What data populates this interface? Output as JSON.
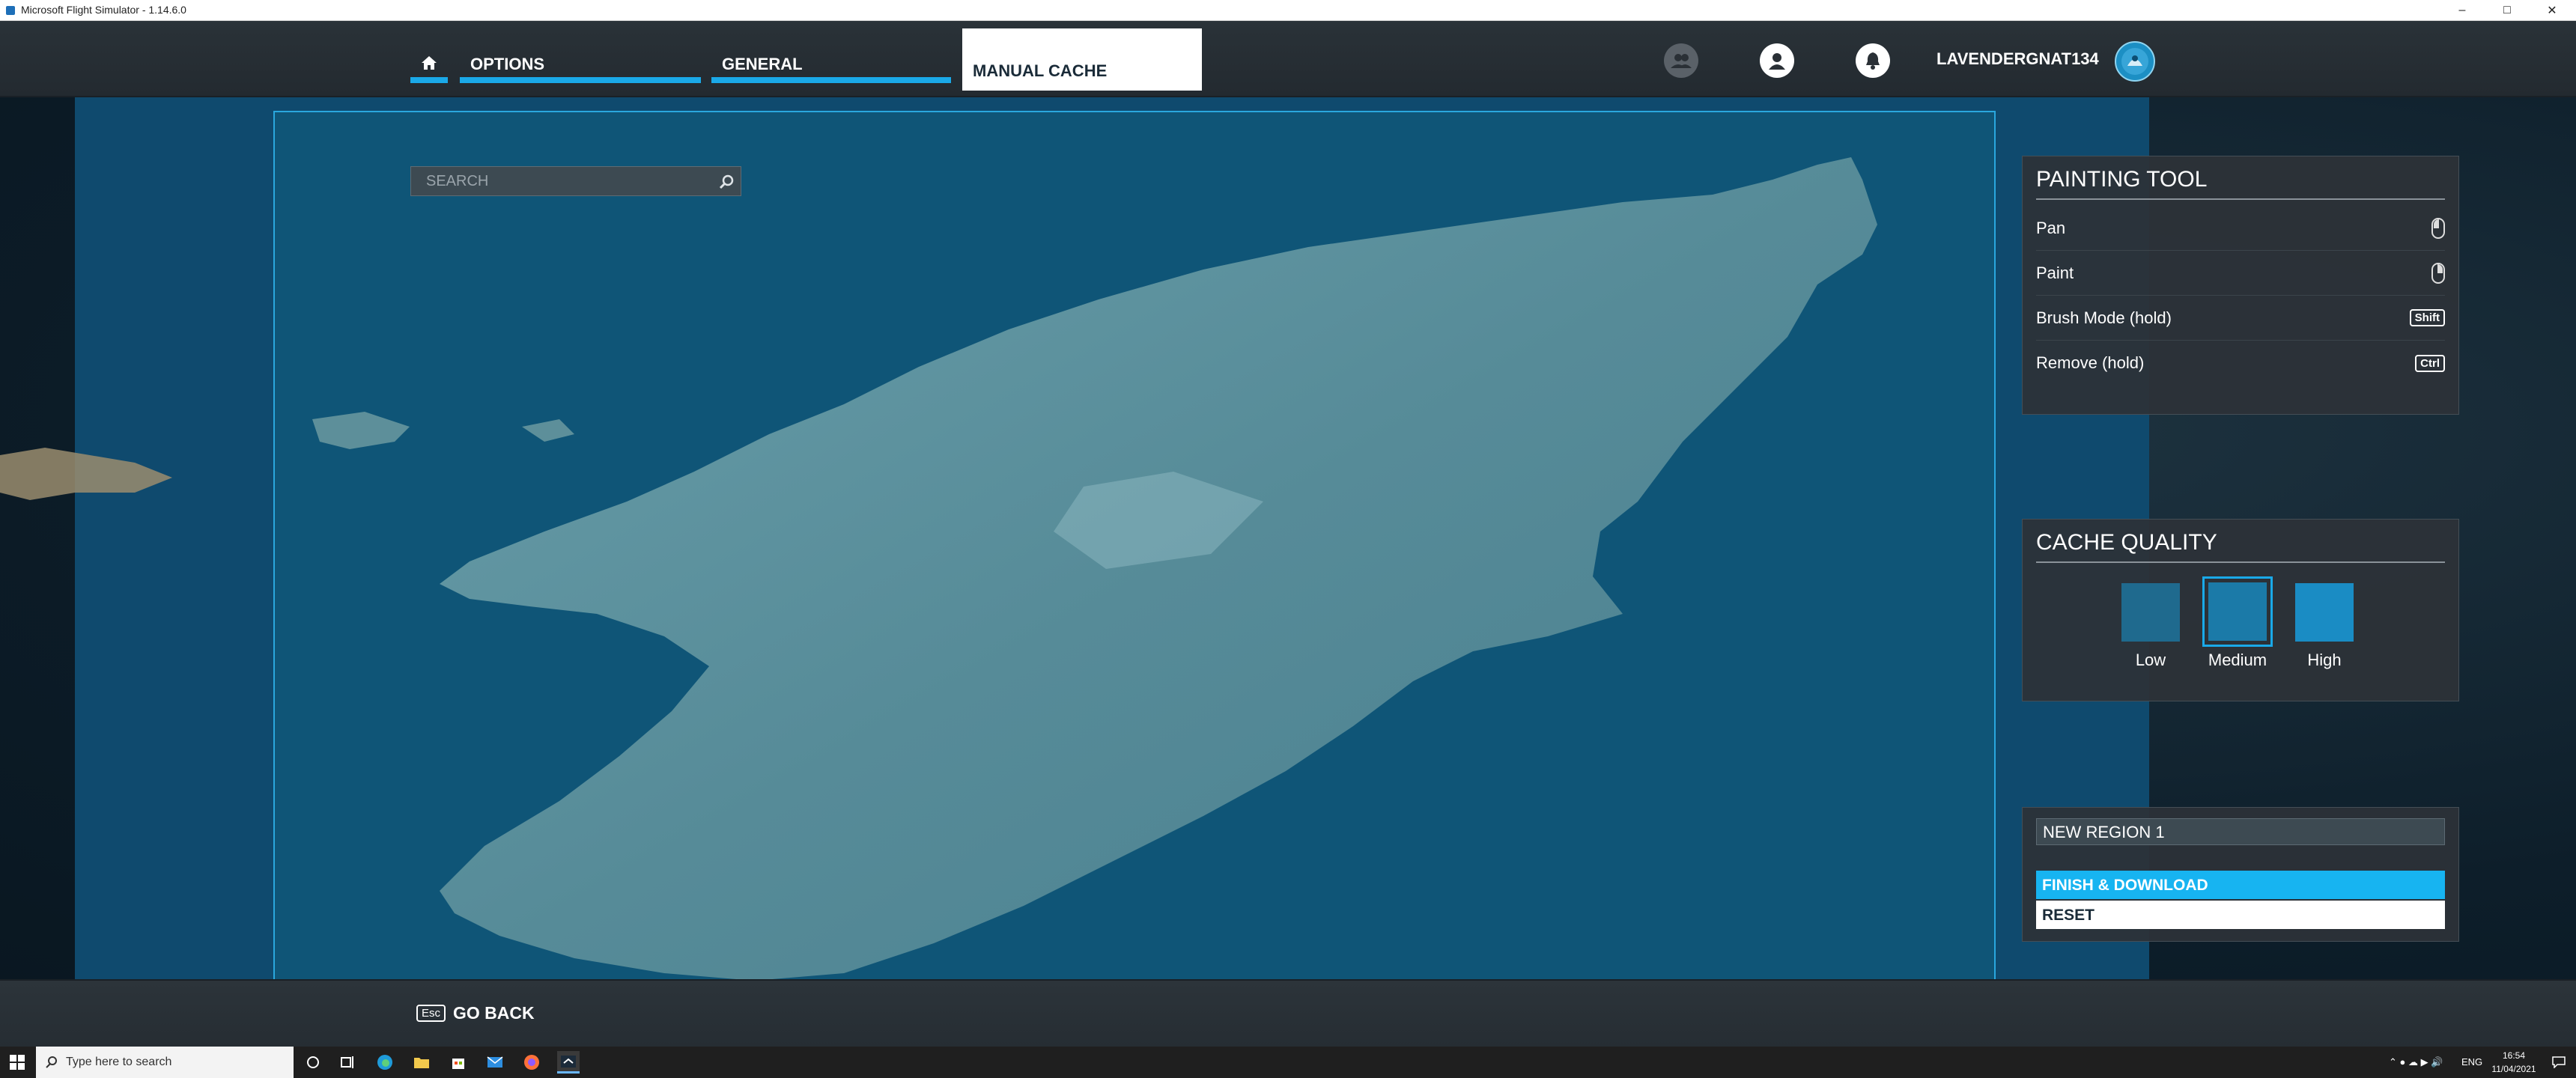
{
  "window": {
    "title": "Microsoft Flight Simulator - 1.14.6.0"
  },
  "nav": {
    "tabs": [
      {
        "label": "OPTIONS"
      },
      {
        "label": "GENERAL"
      },
      {
        "label": "MANUAL CACHE"
      }
    ],
    "username": "LAVENDERGNAT134"
  },
  "search": {
    "placeholder": "SEARCH"
  },
  "painting_tool": {
    "title": "PAINTING TOOL",
    "rows": [
      {
        "label": "Pan",
        "control": "left-mouse-button"
      },
      {
        "label": "Paint",
        "control": "right-mouse-button"
      },
      {
        "label": "Brush Mode (hold)",
        "key": "Shift"
      },
      {
        "label": "Remove (hold)",
        "key": "Ctrl"
      }
    ]
  },
  "cache_quality": {
    "title": "CACHE QUALITY",
    "options": [
      {
        "label": "Low",
        "color": "#1f6a8e"
      },
      {
        "label": "Medium",
        "color": "#1b7aa8"
      },
      {
        "label": "High",
        "color": "#1a8cc4"
      }
    ],
    "selected": "Medium"
  },
  "region": {
    "name": "NEW REGION 1",
    "finish_label": "FINISH & DOWNLOAD",
    "reset_label": "RESET"
  },
  "footer": {
    "esc_key": "Esc",
    "go_back": "GO BACK"
  },
  "taskbar": {
    "search_placeholder": "Type here to search",
    "language": "ENG",
    "time": "16:54",
    "date": "11/04/2021"
  },
  "colors": {
    "accent": "#1aa9e8",
    "finish_button": "#17b4f1"
  }
}
